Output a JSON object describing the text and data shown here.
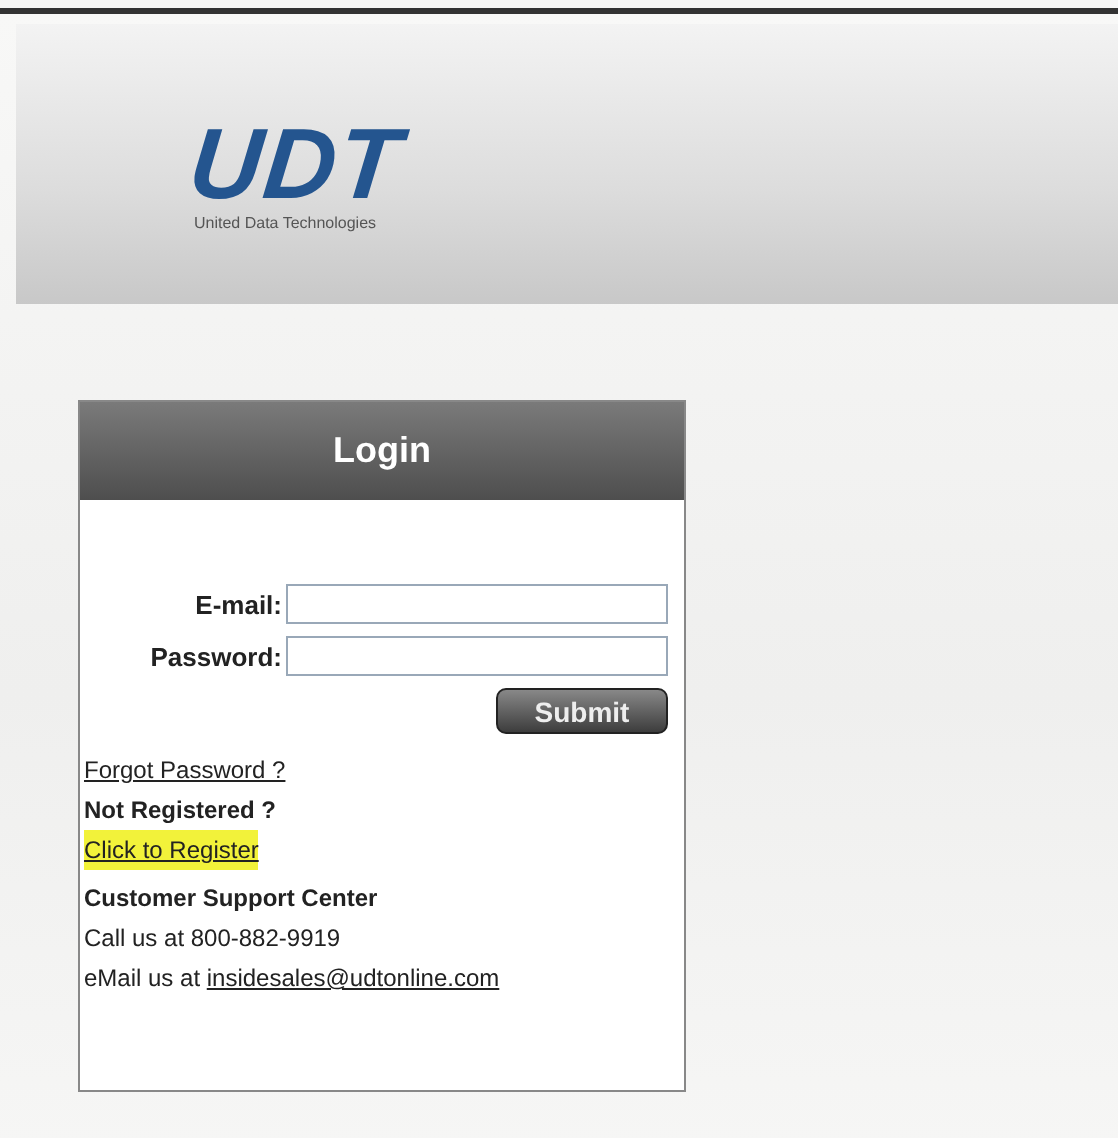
{
  "logo": {
    "mark": "UDT",
    "tagline": "United Data Technologies"
  },
  "login": {
    "title": "Login",
    "fields": [
      {
        "label": "E-mail:"
      },
      {
        "label": "Password:"
      }
    ],
    "submit": "Submit",
    "forgot_link": "Forgot Password ?",
    "register_heading": "Not Registered ?",
    "register_link": {
      "text": "Click to Register",
      "highlighted": true
    },
    "support_heading": "Customer Support Center",
    "phone_line": "Call us at 800-882-9919",
    "email_line": {
      "prefix": "eMail us at",
      "link": "insidesales@udtonline.com"
    }
  }
}
